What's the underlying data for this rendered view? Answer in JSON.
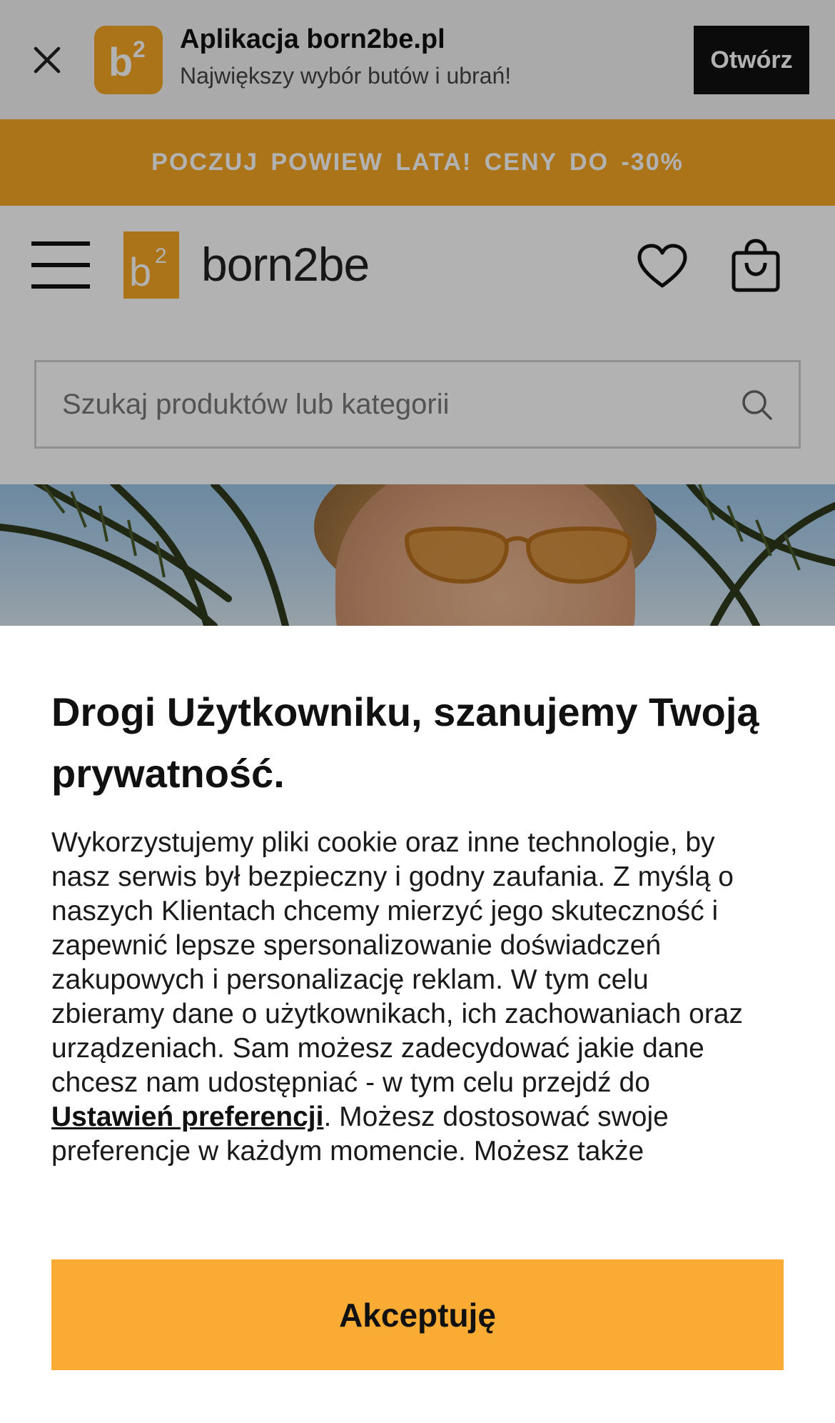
{
  "app_banner": {
    "title": "Aplikacja born2be.pl",
    "subtitle": "Największy wybór butów i ubrań!",
    "open_label": "Otwórz",
    "icon_text": "b2"
  },
  "promo": {
    "text": "POCZUJ POWIEW LATA! CENY DO -30%"
  },
  "header": {
    "logo_text": "born2be"
  },
  "search": {
    "placeholder": "Szukaj produktów lub kategorii"
  },
  "consent": {
    "title": "Drogi Użytkowniku, szanujemy Twoją prywatność.",
    "body_before_link": "Wykorzystujemy pliki cookie oraz inne technologie, by nasz serwis był bezpieczny i godny zaufania. Z myślą o naszych Klientach chcemy mierzyć jego skuteczność i zapewnić lepsze spersonalizowanie doświadczeń zakupowych i personalizację reklam. W tym celu zbieramy dane o użytkownikach, ich zachowaniach oraz urządzeniach. Sam możesz zadecydować jakie dane chcesz nam udostępniać - w tym celu przejdź do ",
    "link_label": "Ustawień preferencji",
    "body_after_link": ". Możesz dostosować swoje preferencje w każdym momencie. Możesz także pozostawić wyłącznie ustawienia techniczne niezbędne do prawidłowego działania naszego serwisu - w tym celu kliknij",
    "accept_label": "Akceptuję"
  },
  "colors": {
    "brand_orange": "#f5a623",
    "accept_button": "#f9ab33",
    "banner_bg": "#f4f4f4",
    "dark": "#111111"
  },
  "icons": [
    "close-icon",
    "app-logo-icon",
    "menu-icon",
    "brand-logo-icon",
    "heart-icon",
    "shopping-bag-icon",
    "search-icon"
  ]
}
